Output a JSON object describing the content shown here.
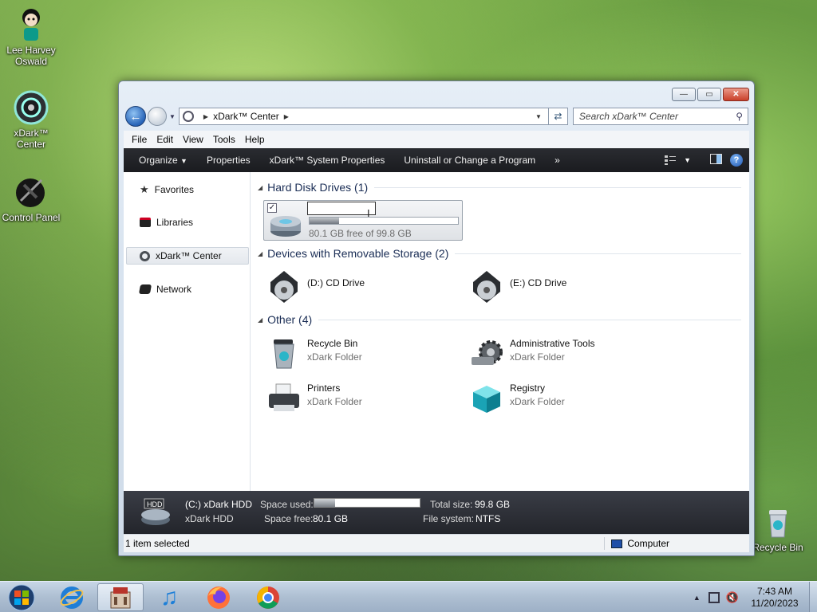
{
  "desktop": {
    "icons": [
      {
        "label": "Lee Harvey\nOswald"
      },
      {
        "label": "xDark™\nCenter"
      },
      {
        "label": "Control Panel"
      },
      {
        "label": "Recycle Bin"
      }
    ]
  },
  "window": {
    "controls": {
      "minimize": "—",
      "maximize": "▭",
      "close": "✕"
    },
    "address": {
      "location": "xDark™ Center"
    },
    "search": {
      "placeholder": "Search xDark™ Center"
    },
    "menu": [
      "File",
      "Edit",
      "View",
      "Tools",
      "Help"
    ],
    "toolbar": {
      "organize": "Organize",
      "properties": "Properties",
      "system_properties": "xDark™ System Properties",
      "uninstall": "Uninstall or Change a Program",
      "more": "»"
    },
    "nav": {
      "favorites": "Favorites",
      "libraries": "Libraries",
      "center": "xDark™ Center",
      "network": "Network"
    },
    "groups": {
      "hdd": "Hard Disk Drives (1)",
      "removable": "Devices with Removable Storage (2)",
      "other": "Other (4)"
    },
    "hdd": {
      "name": "xDark HDD",
      "space": "80.1 GB free of 99.8 GB",
      "used_fraction": 0.2
    },
    "drives": [
      {
        "name": "(D:) CD Drive"
      },
      {
        "name": "(E:) CD Drive"
      }
    ],
    "other": [
      {
        "name": "Recycle Bin",
        "type": "xDark Folder"
      },
      {
        "name": "Administrative Tools",
        "type": "xDark Folder"
      },
      {
        "name": "Printers",
        "type": "xDark Folder"
      },
      {
        "name": "Registry",
        "type": "xDark Folder"
      }
    ],
    "details": {
      "title": "(C:) xDark HDD",
      "subtitle": "xDark HDD",
      "space_used_label": "Space used:",
      "space_free_label": "Space free:",
      "space_free": "80.1 GB",
      "total_size_label": "Total size:",
      "total_size": "99.8 GB",
      "fs_label": "File system:",
      "fs": "NTFS"
    },
    "status": {
      "selected": "1 item selected",
      "computer": "Computer"
    }
  },
  "taskbar": {
    "time": "7:43 AM",
    "date": "11/20/2023"
  }
}
